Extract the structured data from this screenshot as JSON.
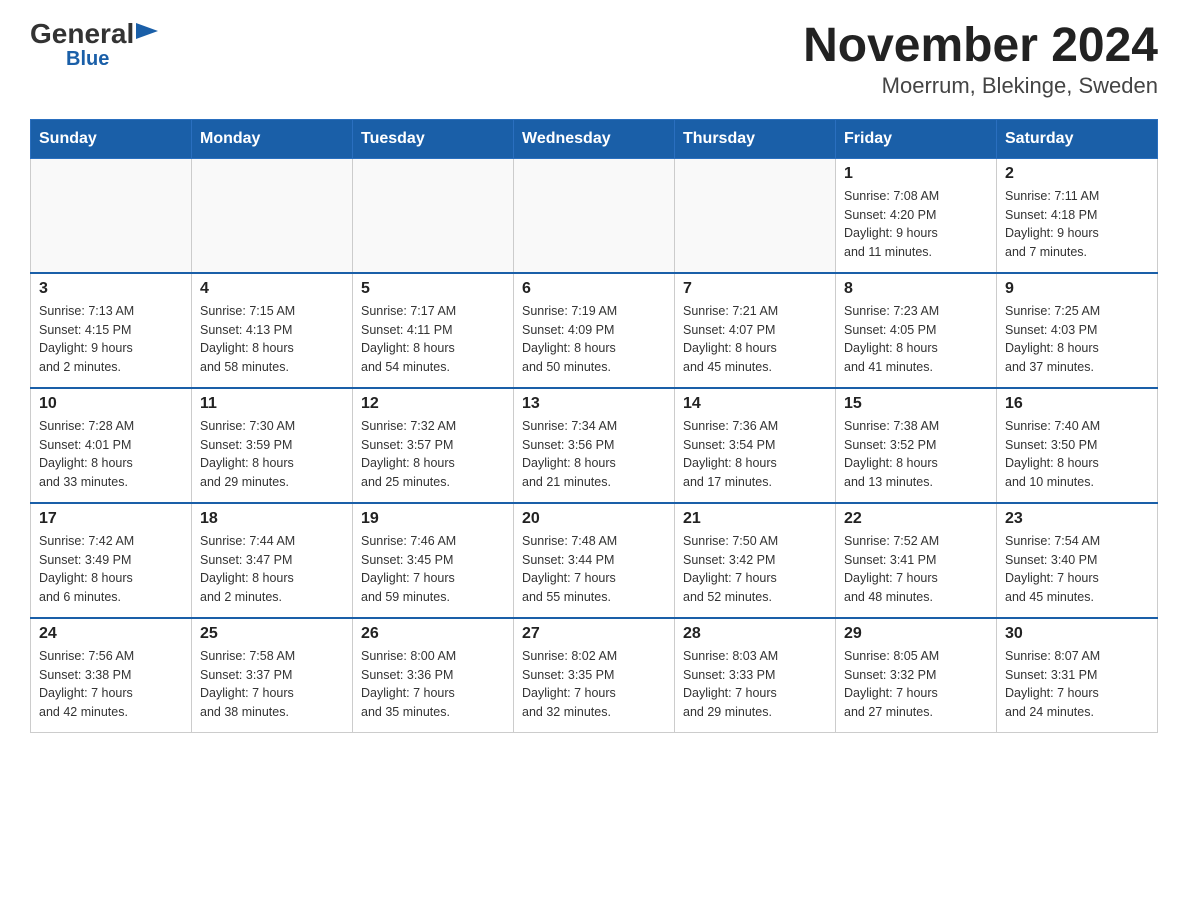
{
  "header": {
    "logo_text": "General",
    "logo_blue": "Blue",
    "title": "November 2024",
    "subtitle": "Moerrum, Blekinge, Sweden"
  },
  "weekdays": [
    "Sunday",
    "Monday",
    "Tuesday",
    "Wednesday",
    "Thursday",
    "Friday",
    "Saturday"
  ],
  "weeks": [
    [
      {
        "day": "",
        "info": ""
      },
      {
        "day": "",
        "info": ""
      },
      {
        "day": "",
        "info": ""
      },
      {
        "day": "",
        "info": ""
      },
      {
        "day": "",
        "info": ""
      },
      {
        "day": "1",
        "info": "Sunrise: 7:08 AM\nSunset: 4:20 PM\nDaylight: 9 hours\nand 11 minutes."
      },
      {
        "day": "2",
        "info": "Sunrise: 7:11 AM\nSunset: 4:18 PM\nDaylight: 9 hours\nand 7 minutes."
      }
    ],
    [
      {
        "day": "3",
        "info": "Sunrise: 7:13 AM\nSunset: 4:15 PM\nDaylight: 9 hours\nand 2 minutes."
      },
      {
        "day": "4",
        "info": "Sunrise: 7:15 AM\nSunset: 4:13 PM\nDaylight: 8 hours\nand 58 minutes."
      },
      {
        "day": "5",
        "info": "Sunrise: 7:17 AM\nSunset: 4:11 PM\nDaylight: 8 hours\nand 54 minutes."
      },
      {
        "day": "6",
        "info": "Sunrise: 7:19 AM\nSunset: 4:09 PM\nDaylight: 8 hours\nand 50 minutes."
      },
      {
        "day": "7",
        "info": "Sunrise: 7:21 AM\nSunset: 4:07 PM\nDaylight: 8 hours\nand 45 minutes."
      },
      {
        "day": "8",
        "info": "Sunrise: 7:23 AM\nSunset: 4:05 PM\nDaylight: 8 hours\nand 41 minutes."
      },
      {
        "day": "9",
        "info": "Sunrise: 7:25 AM\nSunset: 4:03 PM\nDaylight: 8 hours\nand 37 minutes."
      }
    ],
    [
      {
        "day": "10",
        "info": "Sunrise: 7:28 AM\nSunset: 4:01 PM\nDaylight: 8 hours\nand 33 minutes."
      },
      {
        "day": "11",
        "info": "Sunrise: 7:30 AM\nSunset: 3:59 PM\nDaylight: 8 hours\nand 29 minutes."
      },
      {
        "day": "12",
        "info": "Sunrise: 7:32 AM\nSunset: 3:57 PM\nDaylight: 8 hours\nand 25 minutes."
      },
      {
        "day": "13",
        "info": "Sunrise: 7:34 AM\nSunset: 3:56 PM\nDaylight: 8 hours\nand 21 minutes."
      },
      {
        "day": "14",
        "info": "Sunrise: 7:36 AM\nSunset: 3:54 PM\nDaylight: 8 hours\nand 17 minutes."
      },
      {
        "day": "15",
        "info": "Sunrise: 7:38 AM\nSunset: 3:52 PM\nDaylight: 8 hours\nand 13 minutes."
      },
      {
        "day": "16",
        "info": "Sunrise: 7:40 AM\nSunset: 3:50 PM\nDaylight: 8 hours\nand 10 minutes."
      }
    ],
    [
      {
        "day": "17",
        "info": "Sunrise: 7:42 AM\nSunset: 3:49 PM\nDaylight: 8 hours\nand 6 minutes."
      },
      {
        "day": "18",
        "info": "Sunrise: 7:44 AM\nSunset: 3:47 PM\nDaylight: 8 hours\nand 2 minutes."
      },
      {
        "day": "19",
        "info": "Sunrise: 7:46 AM\nSunset: 3:45 PM\nDaylight: 7 hours\nand 59 minutes."
      },
      {
        "day": "20",
        "info": "Sunrise: 7:48 AM\nSunset: 3:44 PM\nDaylight: 7 hours\nand 55 minutes."
      },
      {
        "day": "21",
        "info": "Sunrise: 7:50 AM\nSunset: 3:42 PM\nDaylight: 7 hours\nand 52 minutes."
      },
      {
        "day": "22",
        "info": "Sunrise: 7:52 AM\nSunset: 3:41 PM\nDaylight: 7 hours\nand 48 minutes."
      },
      {
        "day": "23",
        "info": "Sunrise: 7:54 AM\nSunset: 3:40 PM\nDaylight: 7 hours\nand 45 minutes."
      }
    ],
    [
      {
        "day": "24",
        "info": "Sunrise: 7:56 AM\nSunset: 3:38 PM\nDaylight: 7 hours\nand 42 minutes."
      },
      {
        "day": "25",
        "info": "Sunrise: 7:58 AM\nSunset: 3:37 PM\nDaylight: 7 hours\nand 38 minutes."
      },
      {
        "day": "26",
        "info": "Sunrise: 8:00 AM\nSunset: 3:36 PM\nDaylight: 7 hours\nand 35 minutes."
      },
      {
        "day": "27",
        "info": "Sunrise: 8:02 AM\nSunset: 3:35 PM\nDaylight: 7 hours\nand 32 minutes."
      },
      {
        "day": "28",
        "info": "Sunrise: 8:03 AM\nSunset: 3:33 PM\nDaylight: 7 hours\nand 29 minutes."
      },
      {
        "day": "29",
        "info": "Sunrise: 8:05 AM\nSunset: 3:32 PM\nDaylight: 7 hours\nand 27 minutes."
      },
      {
        "day": "30",
        "info": "Sunrise: 8:07 AM\nSunset: 3:31 PM\nDaylight: 7 hours\nand 24 minutes."
      }
    ]
  ]
}
